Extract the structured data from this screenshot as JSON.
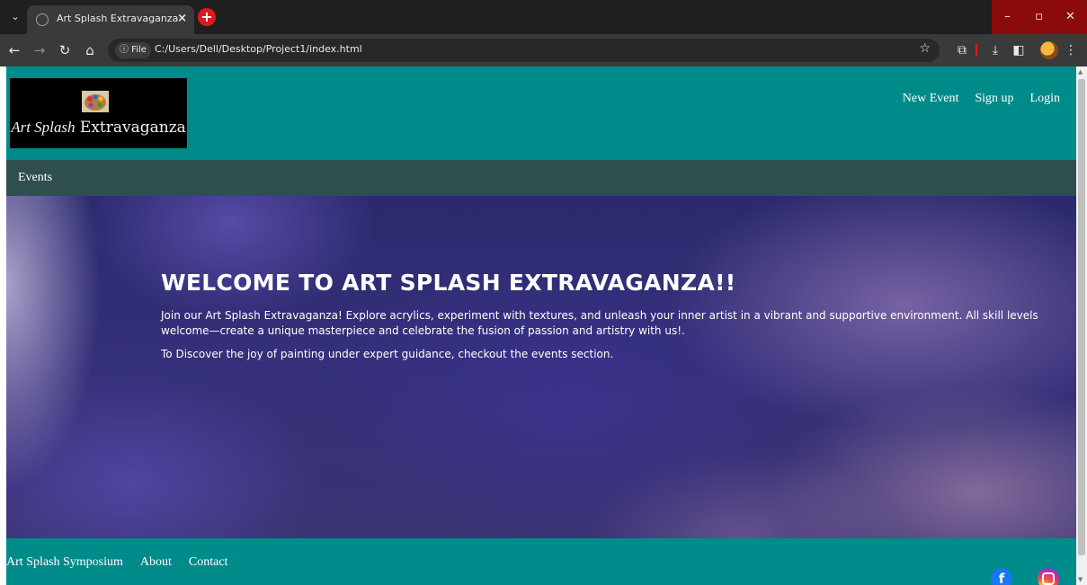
{
  "browser": {
    "tab_title": "Art Splash Extravaganza",
    "tab_close": "×",
    "new_tab": "+",
    "site_info": "ⓘ File",
    "url": "C:/Users/Dell/Desktop/Project1/index.html",
    "win_min": "–",
    "win_max": "▫",
    "win_close": "✕"
  },
  "header": {
    "logo_text_script": "Art Splash",
    "logo_text_plain": " Extravaganza",
    "nav": [
      "New Event",
      "Sign up",
      "Login"
    ]
  },
  "subnav": {
    "events": "Events"
  },
  "hero": {
    "title": "WELCOME TO ART SPLASH EXTRAVAGANZA!!",
    "paragraph1": "Join our Art Splash Extravaganza! Explore acrylics, experiment with textures, and unleash your inner artist in a vibrant and supportive environment. All skill levels welcome—create a unique masterpiece and celebrate the fusion of passion and artistry with us!.",
    "paragraph2": "To Discover the joy of painting under expert guidance, checkout the events section."
  },
  "footer": {
    "links": [
      "Art Splash Symposium",
      "About",
      "Contact"
    ],
    "facebook": "f"
  },
  "colors": {
    "header_bg": "#008b8b",
    "subnav_bg": "#2f4f4f",
    "footer_bg": "#008b8b",
    "facebook": "#1877f2"
  }
}
